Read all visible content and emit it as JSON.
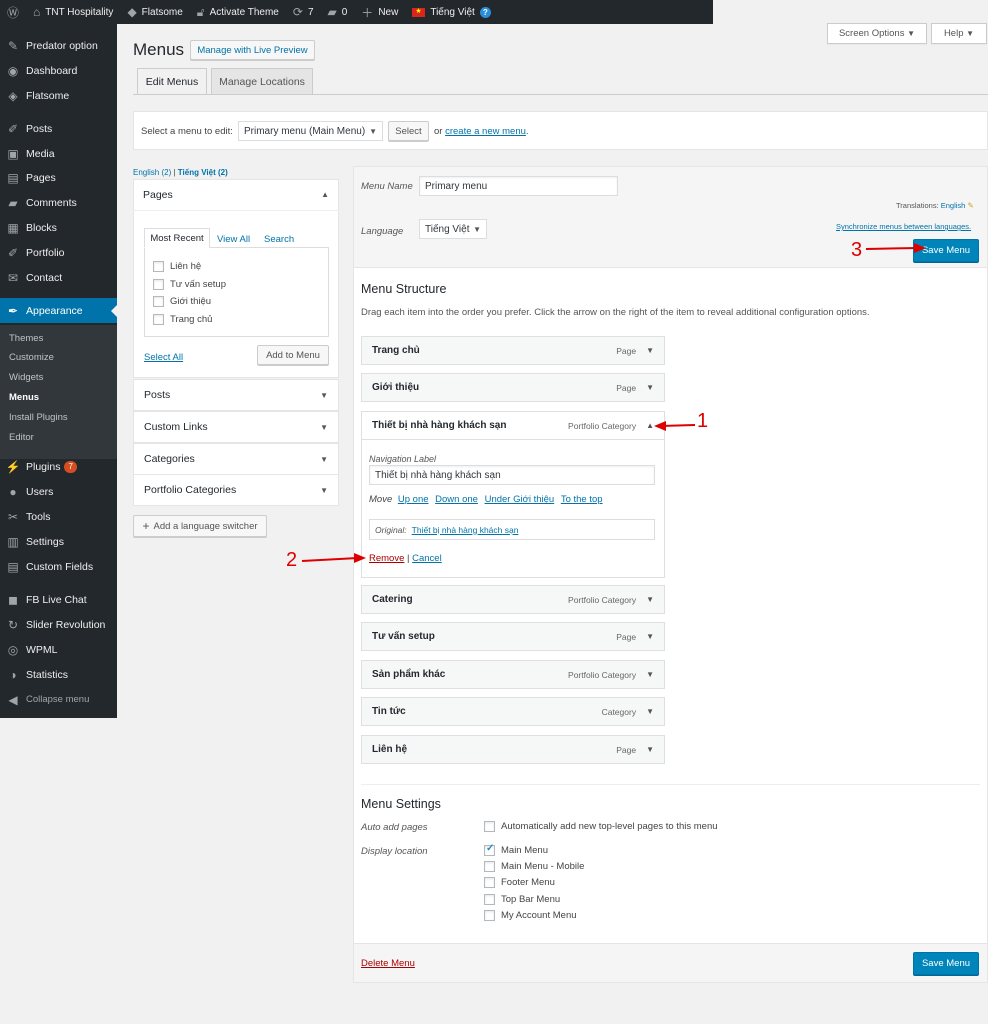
{
  "adminbar": {
    "site": "TNT Hospitality",
    "theme": "Flatsome",
    "activate": "Activate Theme",
    "updates": "7",
    "comments": "0",
    "new": "New",
    "language": "Tiếng Việt"
  },
  "sidebar": {
    "items": [
      {
        "label": "Predator option",
        "icon": "gear-icon"
      },
      {
        "label": "Dashboard",
        "icon": "dashboard-icon"
      },
      {
        "label": "Flatsome",
        "icon": "diamond-icon"
      },
      {
        "label": "Posts",
        "icon": "pin-icon"
      },
      {
        "label": "Media",
        "icon": "media-icon"
      },
      {
        "label": "Pages",
        "icon": "page-icon"
      },
      {
        "label": "Comments",
        "icon": "comment-icon"
      },
      {
        "label": "Blocks",
        "icon": "blocks-icon"
      },
      {
        "label": "Portfolio",
        "icon": "pin-icon"
      },
      {
        "label": "Contact",
        "icon": "mail-icon"
      },
      {
        "label": "Appearance",
        "icon": "brush-icon"
      },
      {
        "label": "Plugins",
        "icon": "plugin-icon",
        "badge": "7"
      },
      {
        "label": "Users",
        "icon": "user-icon"
      },
      {
        "label": "Tools",
        "icon": "wrench-icon"
      },
      {
        "label": "Settings",
        "icon": "settings-icon"
      },
      {
        "label": "Custom Fields",
        "icon": "fields-icon"
      },
      {
        "label": "FB Live Chat",
        "icon": "chat-icon"
      },
      {
        "label": "Slider Revolution",
        "icon": "refresh-icon"
      },
      {
        "label": "WPML",
        "icon": "globe-icon"
      },
      {
        "label": "Statistics",
        "icon": "stats-icon"
      },
      {
        "label": "Collapse menu",
        "icon": "collapse-icon"
      }
    ],
    "submenu": [
      "Themes",
      "Customize",
      "Widgets",
      "Menus",
      "Install Plugins",
      "Editor"
    ]
  },
  "header": {
    "title": "Menus",
    "live_preview": "Manage with Live Preview",
    "screen_options": "Screen Options",
    "help": "Help",
    "tabs": [
      "Edit Menus",
      "Manage Locations"
    ]
  },
  "select_bar": {
    "label": "Select a menu to edit:",
    "selected": "Primary menu (Main Menu)",
    "select_btn": "Select",
    "or": "or",
    "create_link": "create a new menu",
    "period": "."
  },
  "languages": {
    "english": "English (2)",
    "sep": "|",
    "viet": "Tiếng Việt (2)"
  },
  "left_panel": {
    "pages_title": "Pages",
    "tabs": [
      "Most Recent",
      "View All",
      "Search"
    ],
    "page_items": [
      "Liên hệ",
      "Tư vấn setup",
      "Giới thiệu",
      "Trang chủ"
    ],
    "select_all": "Select All",
    "add_to_menu": "Add to Menu",
    "sections": [
      "Posts",
      "Custom Links",
      "Categories",
      "Portfolio Categories"
    ],
    "lang_switcher": "Add a language switcher"
  },
  "menu_edit": {
    "name_label": "Menu Name",
    "name_value": "Primary menu",
    "translations": "Translations:",
    "translations_link": "English",
    "language_label": "Language",
    "language_value": "Tiếng Việt",
    "sync_link": "Synchronize menus between languages.",
    "save": "Save Menu",
    "structure_title": "Menu Structure",
    "structure_desc": "Drag each item into the order you prefer. Click the arrow on the right of the item to reveal additional configuration options.",
    "items": [
      {
        "title": "Trang chủ",
        "type": "Page"
      },
      {
        "title": "Giới thiệu",
        "type": "Page"
      },
      {
        "title": "Thiết bị nhà hàng khách sạn",
        "type": "Portfolio Category"
      },
      {
        "title": "Catering",
        "type": "Portfolio Category"
      },
      {
        "title": "Tư vấn setup",
        "type": "Page"
      },
      {
        "title": "Sản phẩm khác",
        "type": "Portfolio Category"
      },
      {
        "title": "Tin tức",
        "type": "Category"
      },
      {
        "title": "Liên hệ",
        "type": "Page"
      }
    ],
    "expanded": {
      "nav_label": "Navigation Label",
      "nav_value": "Thiết bị nhà hàng khách sạn",
      "move": "Move",
      "move_links": [
        "Up one",
        "Down one",
        "Under Giới thiệu",
        "To the top"
      ],
      "original_label": "Original:",
      "original_link": "Thiết bị nhà hàng khách sạn",
      "remove": "Remove",
      "sep": "|",
      "cancel": "Cancel"
    },
    "settings_title": "Menu Settings",
    "auto_add_label": "Auto add pages",
    "auto_add_text": "Automatically add new top-level pages to this menu",
    "display_label": "Display location",
    "locations": [
      {
        "label": "Main Menu",
        "checked": true
      },
      {
        "label": "Main Menu - Mobile",
        "checked": false
      },
      {
        "label": "Footer Menu",
        "checked": false
      },
      {
        "label": "Top Bar Menu",
        "checked": false
      },
      {
        "label": "My Account Menu",
        "checked": false
      }
    ],
    "delete": "Delete Menu"
  },
  "annotations": [
    "1",
    "2",
    "3"
  ],
  "colors": {
    "admin_dark": "#23282d",
    "accent": "#0073aa",
    "primary_btn": "#0085ba",
    "annotation": "#dd0000"
  }
}
